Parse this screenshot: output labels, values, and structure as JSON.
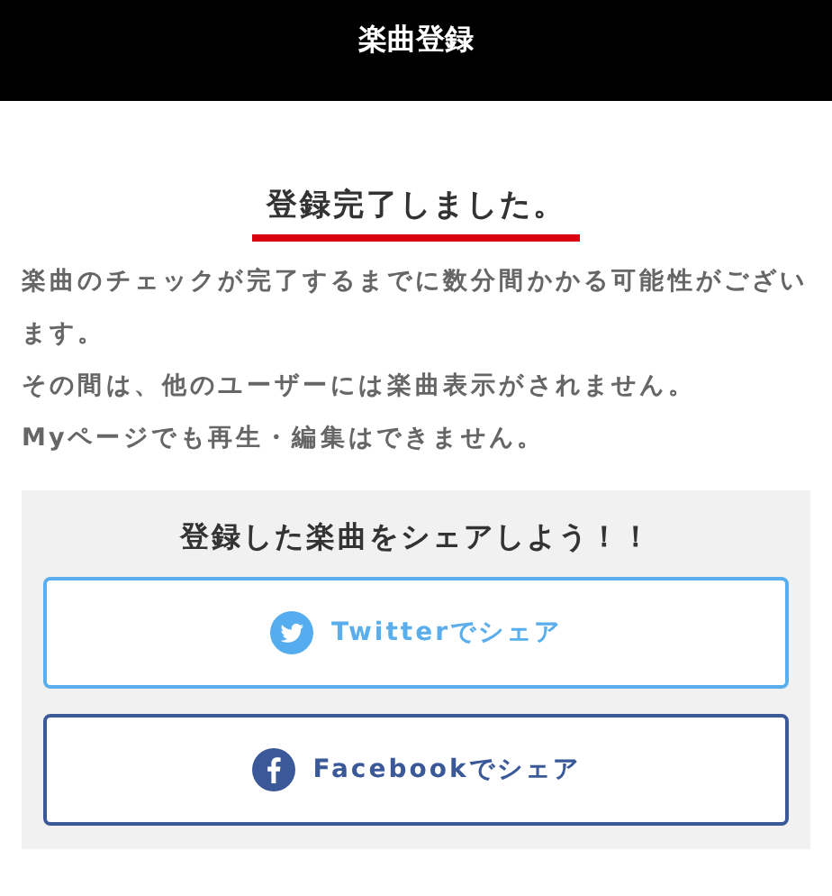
{
  "header": {
    "title": "楽曲登録"
  },
  "heading": "登録完了しました。",
  "paragraphs": [
    "楽曲のチェックが完了するまでに数分間かかる可能性がございます。",
    "その間は、他のユーザーには楽曲表示がされません。",
    "Myページでも再生・編集はできません。"
  ],
  "share": {
    "title": "登録した楽曲をシェアしよう！！",
    "buttons": [
      {
        "kind": "twitter",
        "label": "Twitterでシェア"
      },
      {
        "kind": "facebook",
        "label": "Facebookでシェア"
      }
    ]
  }
}
